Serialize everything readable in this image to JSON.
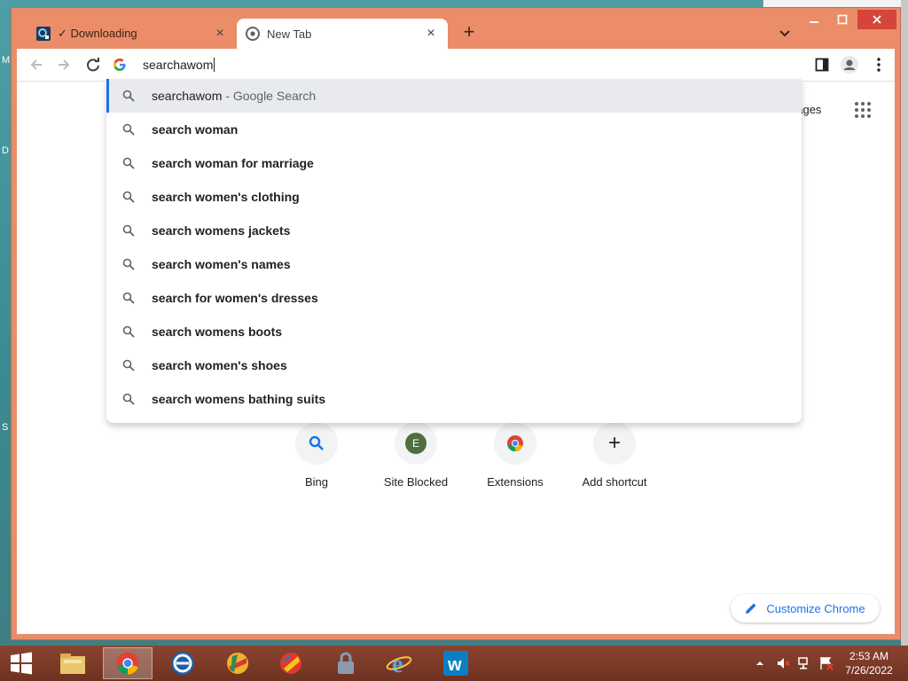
{
  "desktop": {
    "letters": [
      "M",
      "D",
      "S"
    ]
  },
  "tabs": [
    {
      "title": "✓ Downloading",
      "close": "×"
    },
    {
      "title": "New Tab",
      "close": "×"
    }
  ],
  "new_tab_symbol": "+",
  "omnibox": {
    "value": "searchawom"
  },
  "suggestions": [
    {
      "text": "searchawom",
      "suffix": "Google Search",
      "separator": " - ",
      "bold": false
    },
    {
      "text": "search woman",
      "bold": true
    },
    {
      "text": "search woman for marriage",
      "bold": true
    },
    {
      "text": "search women's clothing",
      "bold": true
    },
    {
      "text": "search womens jackets",
      "bold": true
    },
    {
      "text": "search women's names",
      "bold": true
    },
    {
      "text": "search for women's dresses",
      "bold": true
    },
    {
      "text": "search womens boots",
      "bold": true
    },
    {
      "text": "search women's shoes",
      "bold": true
    },
    {
      "text": "search womens bathing suits",
      "bold": true
    }
  ],
  "page": {
    "images_link": "nages",
    "shortcuts": [
      {
        "label": "Bing",
        "tile_letter": ""
      },
      {
        "label": "Site Blocked",
        "tile_letter": "E"
      },
      {
        "label": "Extensions",
        "tile_letter": ""
      },
      {
        "label": "Add shortcut",
        "tile_letter": "+"
      }
    ],
    "customize_label": "Customize Chrome"
  },
  "taskbar": {
    "time": "2:53 AM",
    "date": "7/26/2022"
  },
  "colors": {
    "frame": "#ea8d68",
    "accent": "#1a73e8",
    "taskbar": "#7a3a26"
  }
}
